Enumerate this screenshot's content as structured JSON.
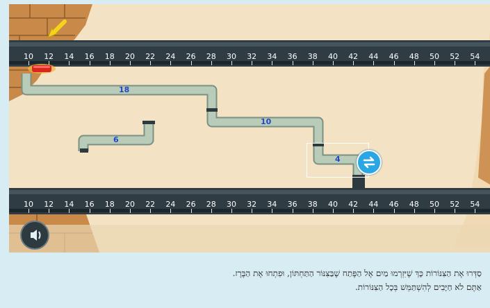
{
  "ruler": {
    "ticks": [
      "10",
      "12",
      "14",
      "16",
      "18",
      "20",
      "22",
      "24",
      "26",
      "28",
      "30",
      "32",
      "34",
      "36",
      "38",
      "40",
      "42",
      "44",
      "46",
      "48",
      "50",
      "52",
      "54"
    ]
  },
  "pipes": {
    "labels": [
      "18",
      "10",
      "6",
      "4"
    ]
  },
  "icons": {
    "valve": "red-valve-icon",
    "indicator": "yellow-arrow-icon",
    "swap": "swap-arrows-icon",
    "sound": "speaker-icon"
  },
  "instructions": {
    "line1": "סַדְּרוּ אֶת הַצִּנּוֹרוֹת כָּךְ שֶׁיִּזְרְמוּ מַיִם אֶל הַפֶּתַח שֶׁבַּצִּנּוֹר הַתַּחְתּוֹן, וּפִתְחוּ אֶת הַבֶּרֶז.",
    "line2": "אַתֶּם לֹא חַיָּבִים לְהִשְׁתַּמֵּשׁ בְּכָל הַצִּנּוֹרוֹת."
  },
  "colors": {
    "ruler_pipe": "#2f3c44",
    "water_pipe": "#b6cbb9",
    "accent": "#2aa6e4",
    "brick": "#c07a3a",
    "label": "#2346c8"
  }
}
